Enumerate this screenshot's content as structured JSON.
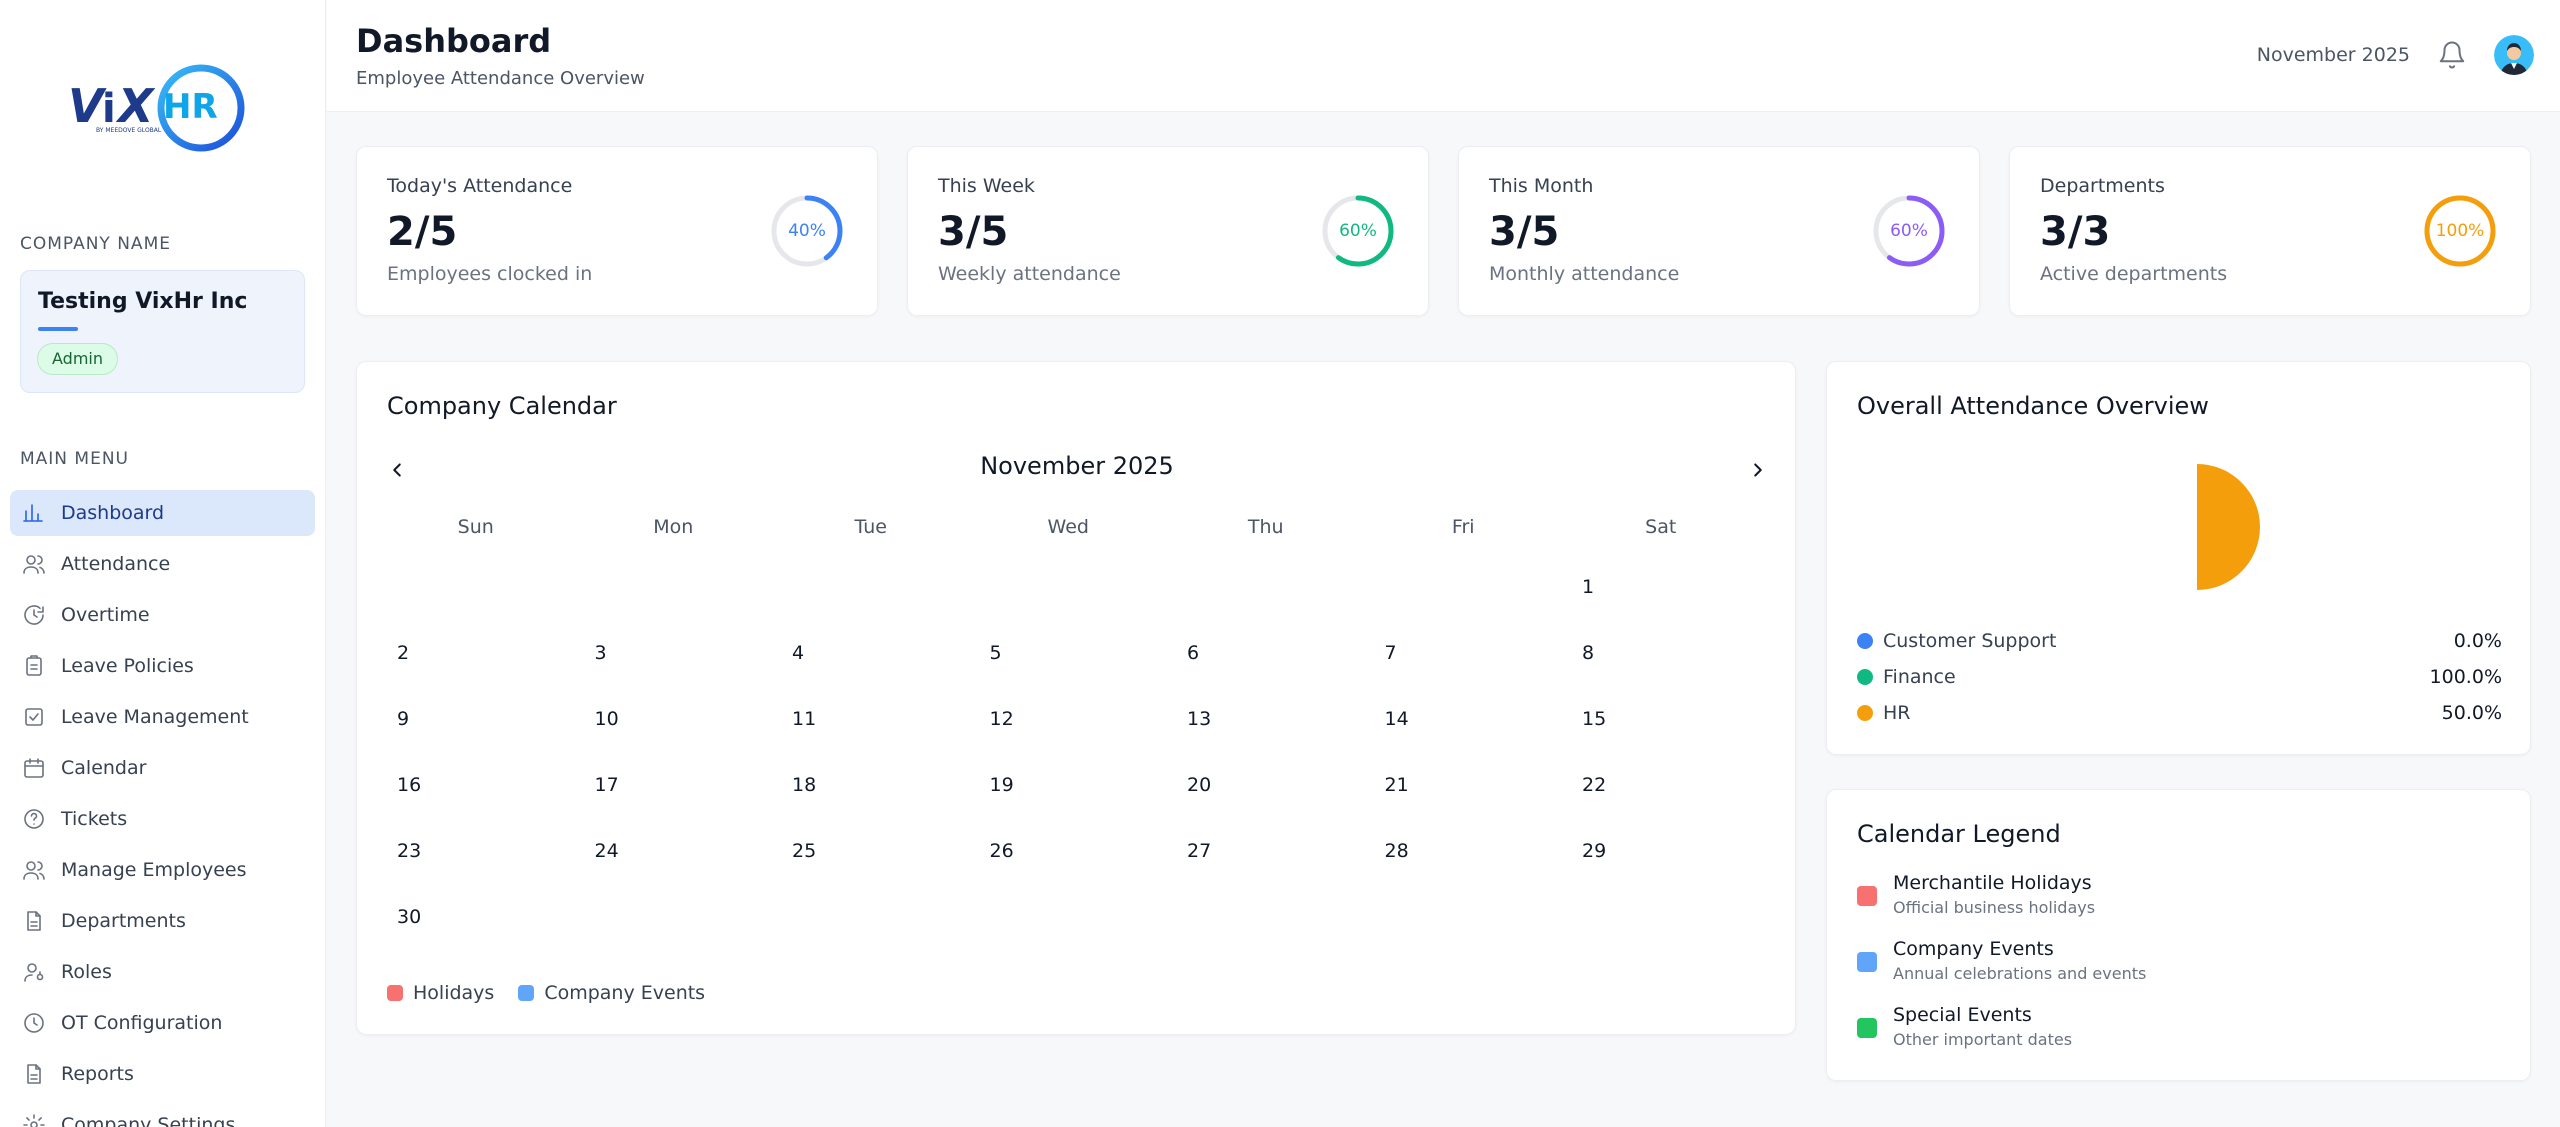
{
  "brand": {
    "logo_text": "VixHR",
    "logo_tagline": "BY MEEDOVE GLOBAL"
  },
  "sidebar": {
    "company_section_label": "COMPANY NAME",
    "company_name": "Testing VixHr Inc",
    "role_badge": "Admin",
    "menu_section_label": "MAIN MENU",
    "items": [
      {
        "label": "Dashboard",
        "icon": "bar-chart-icon",
        "active": true
      },
      {
        "label": "Attendance",
        "icon": "users-icon"
      },
      {
        "label": "Overtime",
        "icon": "clock-arrow-icon"
      },
      {
        "label": "Leave Policies",
        "icon": "clipboard-icon"
      },
      {
        "label": "Leave Management",
        "icon": "checkbox-icon"
      },
      {
        "label": "Calendar",
        "icon": "calendar-icon"
      },
      {
        "label": "Tickets",
        "icon": "help-circle-icon"
      },
      {
        "label": "Manage Employees",
        "icon": "users-icon"
      },
      {
        "label": "Departments",
        "icon": "document-icon"
      },
      {
        "label": "Roles",
        "icon": "user-key-icon"
      },
      {
        "label": "OT Configuration",
        "icon": "clock-icon"
      },
      {
        "label": "Reports",
        "icon": "document-icon"
      },
      {
        "label": "Company Settings",
        "icon": "gear-icon"
      }
    ]
  },
  "header": {
    "title": "Dashboard",
    "subtitle": "Employee Attendance Overview",
    "month": "November 2025"
  },
  "stats": [
    {
      "label": "Today's Attendance",
      "value": "2/5",
      "desc": "Employees clocked in",
      "percent_text": "40%",
      "percent": 40,
      "color": "#3b82f6"
    },
    {
      "label": "This Week",
      "value": "3/5",
      "desc": "Weekly attendance",
      "percent_text": "60%",
      "percent": 60,
      "color": "#10b981"
    },
    {
      "label": "This Month",
      "value": "3/5",
      "desc": "Monthly attendance",
      "percent_text": "60%",
      "percent": 60,
      "color": "#8b5cf6"
    },
    {
      "label": "Departments",
      "value": "3/3",
      "desc": "Active departments",
      "percent_text": "100%",
      "percent": 100,
      "color": "#f59e0b"
    }
  ],
  "calendar": {
    "title": "Company Calendar",
    "month_label": "November 2025",
    "weekdays": [
      "Sun",
      "Mon",
      "Tue",
      "Wed",
      "Thu",
      "Fri",
      "Sat"
    ],
    "weeks": [
      [
        "",
        "",
        "",
        "",
        "",
        "",
        "1"
      ],
      [
        "2",
        "3",
        "4",
        "5",
        "6",
        "7",
        "8"
      ],
      [
        "9",
        "10",
        "11",
        "12",
        "13",
        "14",
        "15"
      ],
      [
        "16",
        "17",
        "18",
        "19",
        "20",
        "21",
        "22"
      ],
      [
        "23",
        "24",
        "25",
        "26",
        "27",
        "28",
        "29"
      ],
      [
        "30",
        "",
        "",
        "",
        "",
        "",
        ""
      ]
    ],
    "legend": [
      {
        "label": "Holidays",
        "color": "#f87171"
      },
      {
        "label": "Company Events",
        "color": "#60a5fa"
      }
    ]
  },
  "overview": {
    "title": "Overall Attendance Overview",
    "rows": [
      {
        "name": "Customer Support",
        "value": "0.0%",
        "color": "#3b82f6"
      },
      {
        "name": "Finance",
        "value": "100.0%",
        "color": "#10b981"
      },
      {
        "name": "HR",
        "value": "50.0%",
        "color": "#f59e0b"
      }
    ]
  },
  "chart_data": {
    "type": "pie",
    "categories": [
      "Customer Support",
      "Finance",
      "HR"
    ],
    "values": [
      0.0,
      100.0,
      50.0
    ],
    "colors": [
      "#3b82f6",
      "#10b981",
      "#f59e0b"
    ],
    "visible_slice": "HR (right half only)"
  },
  "legend_card": {
    "title": "Calendar Legend",
    "items": [
      {
        "title": "Merchantile Holidays",
        "sub": "Official business holidays",
        "color": "#f87171"
      },
      {
        "title": "Company Events",
        "sub": "Annual celebrations and events",
        "color": "#60a5fa"
      },
      {
        "title": "Special Events",
        "sub": "Other important dates",
        "color": "#22c55e"
      }
    ]
  }
}
